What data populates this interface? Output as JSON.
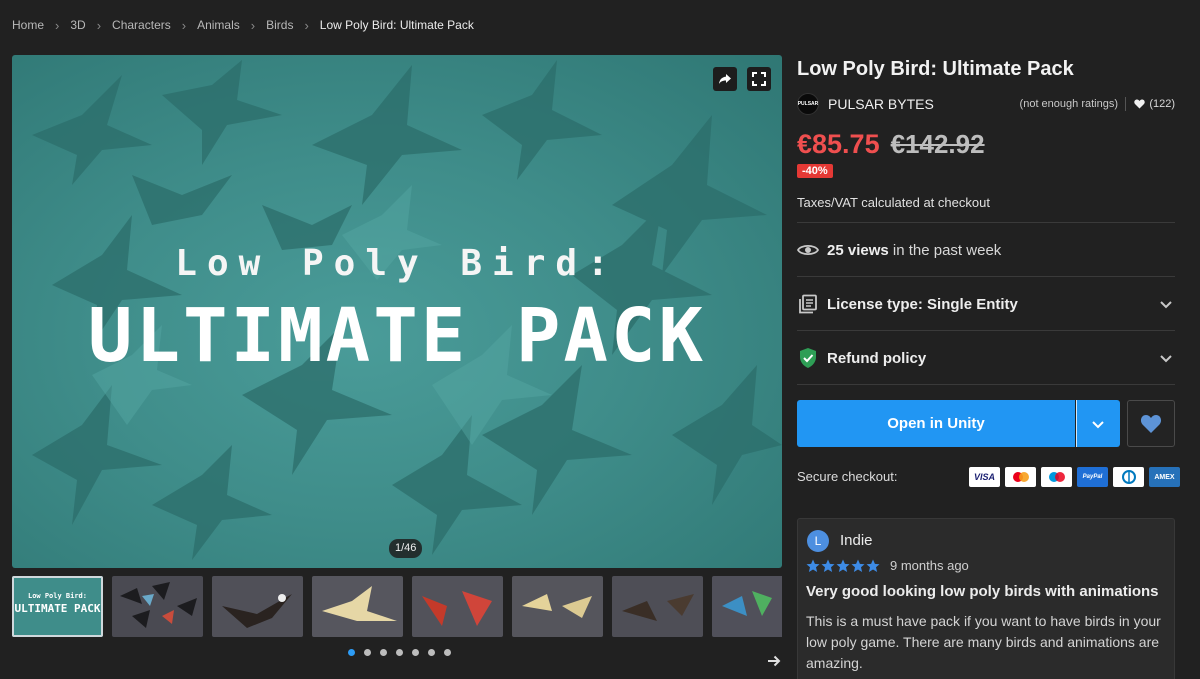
{
  "breadcrumb": {
    "items": [
      "Home",
      "3D",
      "Characters",
      "Animals",
      "Birds"
    ],
    "current": "Low Poly Bird: Ultimate Pack"
  },
  "hero": {
    "title_small": "Low Poly Bird:",
    "title_big": "ULTIMATE PACK",
    "counter": "1/46",
    "share_icon": "share-icon",
    "fullscreen_icon": "fullscreen-icon",
    "background_color": "#3f8d8a"
  },
  "thumbnails": {
    "first_label_small": "Low Poly Bird:",
    "first_label_big": "ULTIMATE PACK",
    "count_visible": 8
  },
  "pagination": {
    "dots": 7,
    "active_index": 0
  },
  "product": {
    "title": "Low Poly Bird: Ultimate Pack",
    "publisher": "PULSAR BYTES",
    "publisher_logo_text": "PULSAR",
    "ratings_text": "(not enough ratings)",
    "favorites_count": "(122)",
    "price": "€85.75",
    "original_price": "€142.92",
    "discount": "-40%",
    "taxes_note": "Taxes/VAT calculated at checkout",
    "views_count": "25 views",
    "views_suffix": " in the past week",
    "license_label": "License type: Single Entity",
    "refund_label": "Refund policy",
    "primary_button": "Open in Unity",
    "secure_checkout": "Secure checkout:",
    "accent_color": "#2196f3",
    "price_color": "#ef4f4f"
  },
  "payment_cards": [
    {
      "name": "VISA",
      "icon": "visa-icon"
    },
    {
      "name": "Mastercard",
      "icon": "mastercard-icon"
    },
    {
      "name": "Maestro",
      "icon": "maestro-icon"
    },
    {
      "name": "PayPal",
      "icon": "paypal-icon"
    },
    {
      "name": "Diners",
      "icon": "diners-icon"
    },
    {
      "name": "AMEX",
      "icon": "amex-icon"
    }
  ],
  "review": {
    "avatar_letter": "L",
    "reviewer": "Indie",
    "stars": 5,
    "time": "9 months ago",
    "title": "Very good looking low poly birds with animations",
    "body": "This is a must have pack if you want to have birds in your low poly game. There are many birds and animations are amazing."
  }
}
